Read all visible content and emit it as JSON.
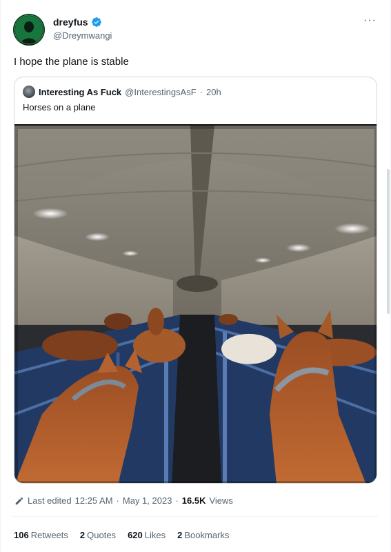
{
  "author": {
    "display_name": "dreyfus",
    "handle": "@Dreymwangi",
    "verified_badge_color": "#1d9bf0",
    "avatar_icon": "avatar-green-portrait"
  },
  "more_menu": {
    "label": "···"
  },
  "tweet": {
    "text": "I hope the plane is stable"
  },
  "quoted": {
    "display_name": "Interesting As Fuck",
    "handle": "@InterestingsAsF",
    "separator": "·",
    "age": "20h",
    "text": "Horses on a plane",
    "media_description_icon": "photo-horses-in-cargo-plane"
  },
  "meta": {
    "edited_label": "Last edited",
    "time": "12:25 AM",
    "dot1": "·",
    "date": "May 1, 2023",
    "dot2": "·",
    "views_count": "16.5K",
    "views_label": "Views"
  },
  "stats": {
    "retweets_count": "106",
    "retweets_label": "Retweets",
    "quotes_count": "2",
    "quotes_label": "Quotes",
    "likes_count": "620",
    "likes_label": "Likes",
    "bookmarks_count": "2",
    "bookmarks_label": "Bookmarks"
  }
}
